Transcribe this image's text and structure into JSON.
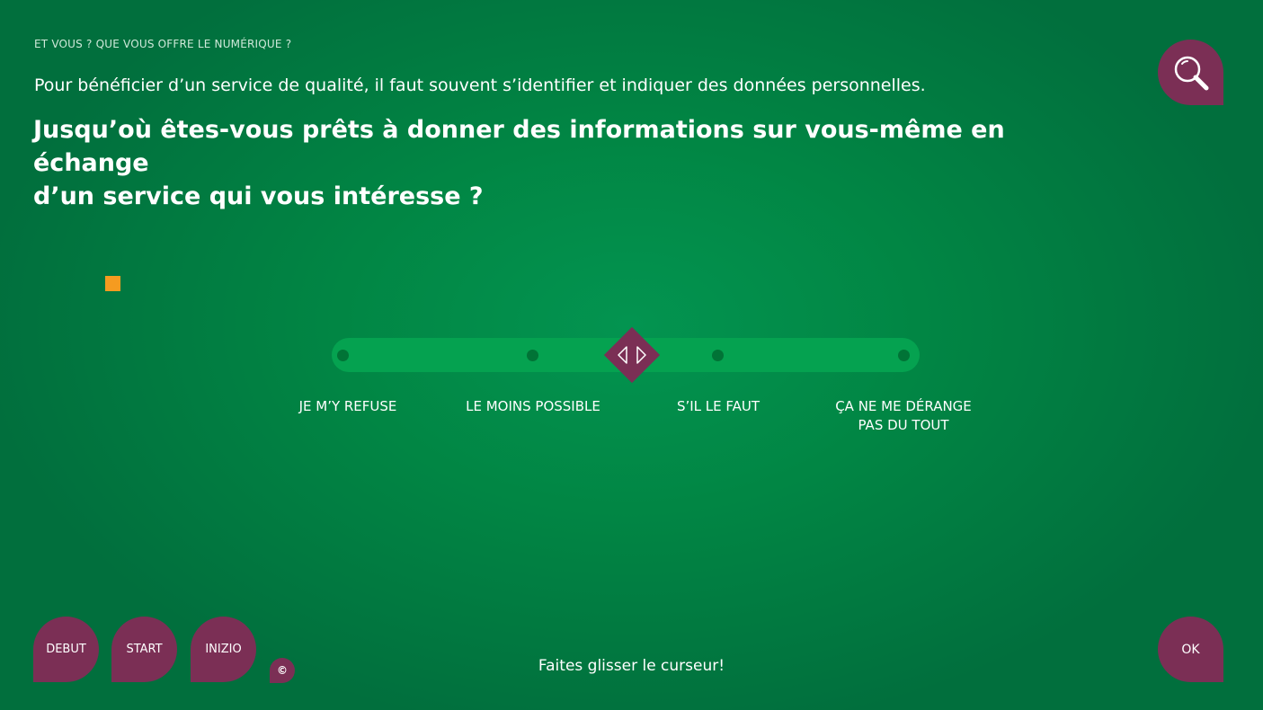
{
  "header": {
    "section_label": "ET VOUS ? QUE VOUS OFFRE LE NUMÉRIQUE ?",
    "intro": "Pour bénéficier d’un service de qualité, il faut souvent s’identifier et indiquer des données personnelles.",
    "question_line1": "Jusqu’où êtes-vous prêts à donner des informations sur vous-même en échange",
    "question_line2": "d’un service qui vous intéresse ?"
  },
  "zoom_button": {
    "icon": "magnifier-icon"
  },
  "slider": {
    "options": [
      {
        "line1": "JE M’Y REFUSE",
        "line2": ""
      },
      {
        "line1": "LE MOINS POSSIBLE",
        "line2": ""
      },
      {
        "line1": "S’IL LE FAUT",
        "line2": ""
      },
      {
        "line1": "ÇA NE ME DÉRANGE",
        "line2": "PAS DU TOUT"
      }
    ],
    "handle_position_fraction": 0.5,
    "handle_icon": "left-right-arrows-icon"
  },
  "footer": {
    "nav_buttons": [
      "DEBUT",
      "START",
      "INIZIO"
    ],
    "copyright": "©",
    "hint": "Faites glisser le curseur!",
    "ok": "OK"
  },
  "colors": {
    "background": "#018644",
    "accent": "#7b2f55",
    "track": "#05a250",
    "marker": "#f59b20"
  }
}
